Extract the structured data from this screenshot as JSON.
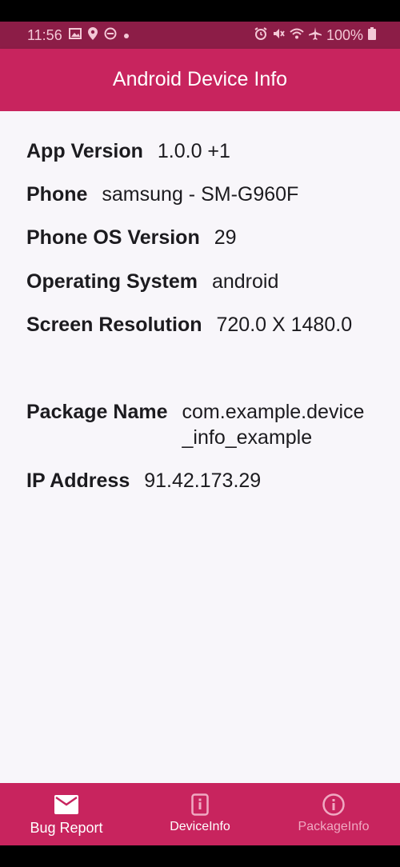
{
  "status_bar": {
    "time": "11:56",
    "battery": "100%",
    "left_icons": [
      "image-icon",
      "location-icon",
      "dnd-icon",
      "dot-icon"
    ],
    "right_icons": [
      "alarm-icon",
      "mute-icon",
      "wifi-icon",
      "airplane-icon",
      "battery-icon"
    ]
  },
  "appbar": {
    "title": "Android Device Info"
  },
  "info": {
    "app_version": {
      "label": "App Version",
      "value": "1.0.0 +1"
    },
    "phone": {
      "label": "Phone",
      "value": "samsung - SM-G960F"
    },
    "os_version": {
      "label": "Phone OS Version",
      "value": "29"
    },
    "os": {
      "label": "Operating System",
      "value": "android"
    },
    "resolution": {
      "label": "Screen Resolution",
      "value": "720.0 X 1480.0"
    },
    "package": {
      "label": "Package Name",
      "value": "com.example.device_info_example"
    },
    "ip": {
      "label": "IP Address",
      "value": "91.42.173.29"
    }
  },
  "bottom_nav": {
    "items": [
      {
        "label": "Bug Report",
        "icon": "mail-icon"
      },
      {
        "label": "DeviceInfo",
        "icon": "phone-icon"
      },
      {
        "label": "PackageInfo",
        "icon": "info-icon"
      }
    ]
  },
  "colors": {
    "primary": "#c8245e",
    "status_bar": "#8c1d47",
    "background": "#f8f6fa"
  }
}
